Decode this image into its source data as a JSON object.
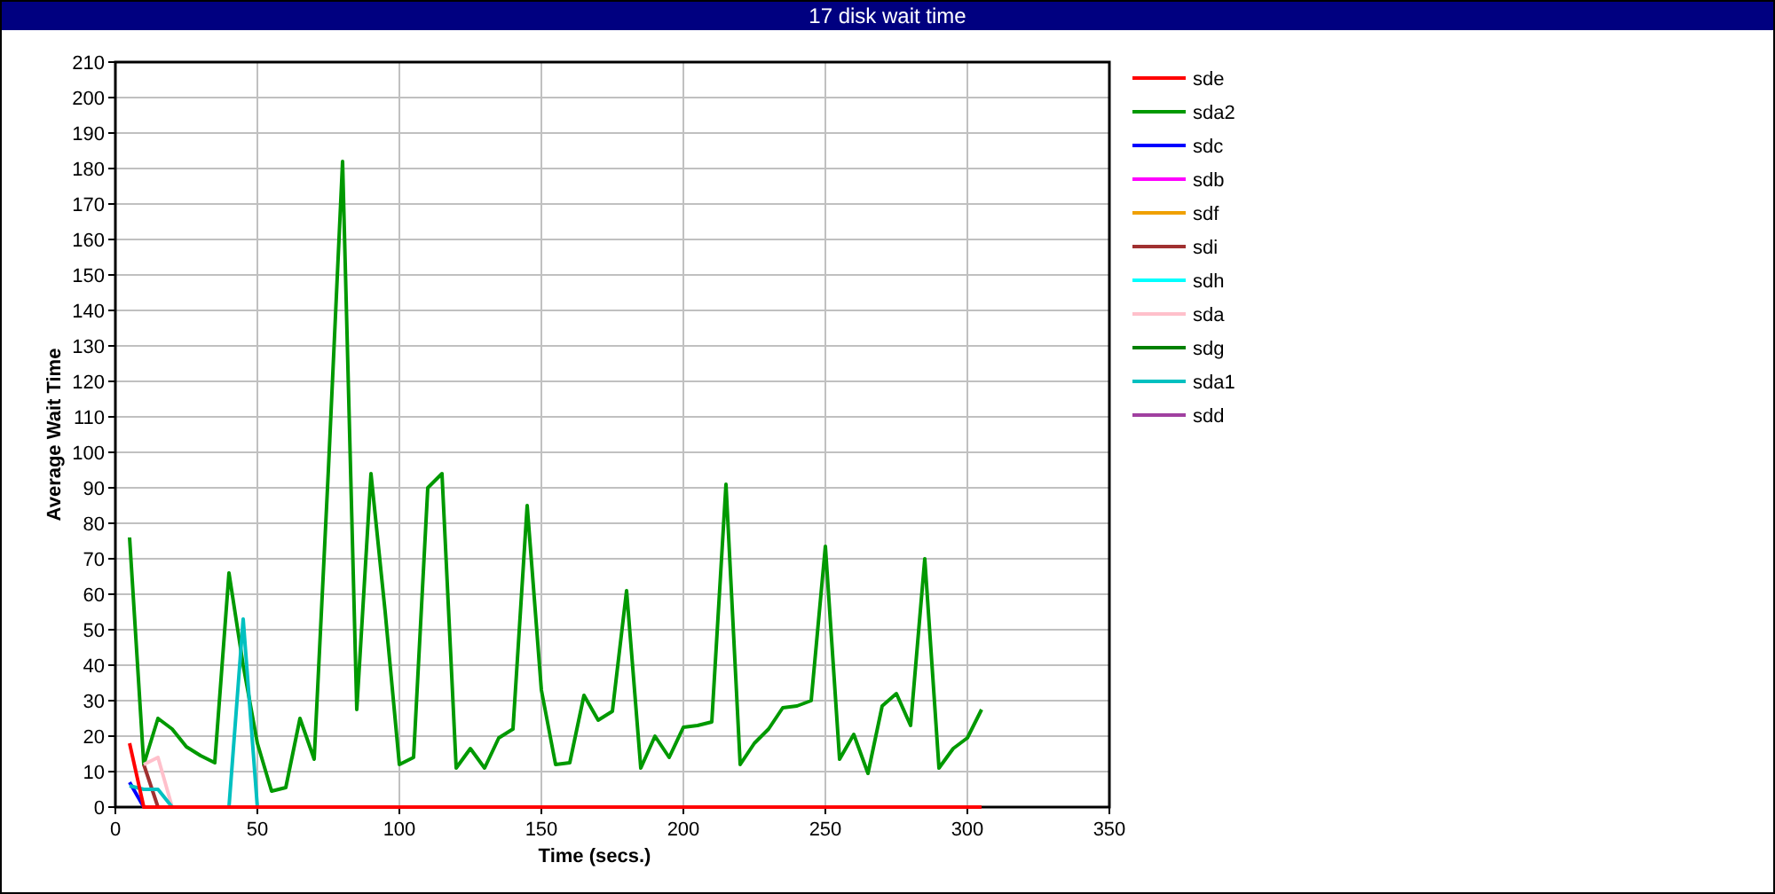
{
  "window": {
    "title": "17 disk wait time"
  },
  "chart_data": {
    "type": "line",
    "grid": true,
    "legend": true,
    "xlabel": "Time (secs.)",
    "ylabel": "Average Wait Time",
    "xlim": [
      0,
      350
    ],
    "ylim": [
      0,
      210
    ],
    "xticks": [
      0,
      50,
      100,
      150,
      200,
      250,
      300,
      350
    ],
    "yticks": [
      0,
      10,
      20,
      30,
      40,
      50,
      60,
      70,
      80,
      90,
      100,
      110,
      120,
      130,
      140,
      150,
      160,
      170,
      180,
      190,
      200,
      210
    ],
    "x": [
      5,
      10,
      15,
      20,
      25,
      30,
      35,
      40,
      45,
      50,
      55,
      60,
      65,
      70,
      75,
      80,
      85,
      90,
      95,
      100,
      105,
      110,
      115,
      120,
      125,
      130,
      135,
      140,
      145,
      150,
      155,
      160,
      165,
      170,
      175,
      180,
      185,
      190,
      195,
      200,
      205,
      210,
      215,
      220,
      225,
      230,
      235,
      240,
      245,
      250,
      255,
      260,
      265,
      270,
      275,
      280,
      285,
      290,
      295,
      300,
      305
    ],
    "series": [
      {
        "name": "sde",
        "color": "#ff0000",
        "values": [
          18,
          0,
          0,
          0,
          0,
          0,
          0,
          0,
          0,
          0,
          0,
          0,
          0,
          0,
          0,
          0,
          0,
          0,
          0,
          0,
          0,
          0,
          0,
          0,
          0,
          0,
          0,
          0,
          0,
          0,
          0,
          0,
          0,
          0,
          0,
          0,
          0,
          0,
          0,
          0,
          0,
          0,
          0,
          0,
          0,
          0,
          0,
          0,
          0,
          0,
          0,
          0,
          0,
          0,
          0,
          0,
          0,
          0,
          0,
          0,
          0
        ]
      },
      {
        "name": "sda2",
        "color": "#009900",
        "values": [
          76,
          12,
          25,
          22,
          17,
          14.5,
          12.5,
          66,
          40,
          18,
          4.5,
          5.5,
          25,
          13.5,
          95,
          182,
          27.5,
          94,
          55,
          12,
          14,
          90,
          94,
          11,
          16.5,
          11,
          19.5,
          22,
          85,
          33,
          12,
          12.5,
          31.5,
          24.5,
          27,
          61,
          11,
          20,
          14,
          22.5,
          23,
          24,
          91,
          12,
          18,
          22,
          28,
          28.5,
          30,
          73.5,
          13.5,
          20.5,
          9.5,
          28.5,
          32,
          23,
          70,
          11,
          16.5,
          19.5,
          27.5
        ]
      },
      {
        "name": "sdc",
        "color": "#0000ff",
        "values": [
          7,
          0,
          null,
          null,
          null,
          null,
          null,
          null,
          null,
          null,
          null,
          null,
          null,
          null,
          null,
          null,
          null,
          null,
          null,
          null,
          null,
          null,
          null,
          null,
          null,
          null,
          null,
          null,
          null,
          null,
          null,
          null,
          null,
          null,
          null,
          null,
          null,
          null,
          null,
          null,
          null,
          null,
          null,
          null,
          null,
          null,
          null,
          null,
          null,
          null,
          null,
          null,
          null,
          null,
          null,
          null,
          null,
          null,
          null,
          null,
          null
        ]
      },
      {
        "name": "sdb",
        "color": "#ff00ff",
        "values": [
          null,
          null,
          null,
          null,
          null,
          null,
          null,
          null,
          null,
          null,
          null,
          null,
          null,
          null,
          null,
          null,
          null,
          null,
          null,
          null,
          null,
          null,
          null,
          null,
          null,
          null,
          null,
          null,
          null,
          null,
          null,
          null,
          null,
          null,
          null,
          null,
          null,
          null,
          null,
          null,
          null,
          null,
          null,
          null,
          null,
          null,
          null,
          null,
          null,
          null,
          null,
          null,
          null,
          null,
          null,
          null,
          null,
          null,
          null,
          null,
          null
        ]
      },
      {
        "name": "sdf",
        "color": "#f0a000",
        "values": [
          null,
          null,
          null,
          null,
          null,
          null,
          null,
          null,
          null,
          null,
          null,
          null,
          null,
          null,
          null,
          null,
          null,
          null,
          null,
          null,
          null,
          null,
          null,
          null,
          null,
          null,
          null,
          null,
          null,
          null,
          null,
          null,
          null,
          null,
          null,
          null,
          null,
          null,
          null,
          null,
          null,
          null,
          null,
          null,
          null,
          null,
          null,
          null,
          null,
          null,
          null,
          null,
          null,
          null,
          null,
          null,
          null,
          null,
          null,
          null,
          null
        ]
      },
      {
        "name": "sdi",
        "color": "#a03030",
        "values": [
          null,
          12,
          0,
          null,
          null,
          null,
          null,
          null,
          null,
          null,
          null,
          null,
          null,
          null,
          null,
          null,
          null,
          null,
          null,
          null,
          null,
          null,
          null,
          null,
          null,
          null,
          null,
          null,
          null,
          null,
          null,
          null,
          null,
          null,
          null,
          null,
          null,
          null,
          null,
          null,
          null,
          null,
          null,
          null,
          null,
          null,
          null,
          null,
          null,
          null,
          null,
          null,
          null,
          null,
          null,
          null,
          null,
          null,
          null,
          null,
          null
        ]
      },
      {
        "name": "sdh",
        "color": "#00ffff",
        "values": [
          null,
          null,
          null,
          null,
          null,
          null,
          null,
          null,
          null,
          null,
          null,
          null,
          null,
          null,
          null,
          null,
          null,
          null,
          null,
          null,
          null,
          null,
          null,
          null,
          null,
          null,
          null,
          null,
          null,
          null,
          null,
          null,
          null,
          null,
          null,
          null,
          null,
          null,
          null,
          null,
          null,
          null,
          null,
          null,
          null,
          null,
          null,
          null,
          null,
          null,
          null,
          null,
          null,
          null,
          null,
          null,
          null,
          null,
          null,
          null,
          null
        ]
      },
      {
        "name": "sda",
        "color": "#ffc0cb",
        "values": [
          null,
          12,
          14,
          0,
          null,
          null,
          null,
          null,
          null,
          null,
          null,
          null,
          null,
          null,
          null,
          null,
          null,
          null,
          null,
          null,
          null,
          null,
          null,
          null,
          null,
          null,
          null,
          null,
          null,
          null,
          null,
          null,
          null,
          null,
          null,
          null,
          null,
          null,
          null,
          null,
          null,
          null,
          null,
          null,
          null,
          null,
          null,
          null,
          null,
          null,
          null,
          null,
          null,
          null,
          null,
          null,
          null,
          null,
          null,
          null,
          null
        ]
      },
      {
        "name": "sdg",
        "color": "#008000",
        "values": [
          null,
          null,
          null,
          null,
          null,
          null,
          null,
          null,
          null,
          null,
          null,
          null,
          null,
          null,
          null,
          null,
          null,
          null,
          null,
          null,
          null,
          null,
          null,
          null,
          null,
          null,
          null,
          null,
          null,
          null,
          null,
          null,
          null,
          null,
          null,
          null,
          null,
          null,
          null,
          null,
          null,
          null,
          null,
          null,
          null,
          null,
          null,
          null,
          null,
          null,
          null,
          null,
          null,
          null,
          null,
          null,
          null,
          null,
          null,
          null,
          null
        ]
      },
      {
        "name": "sda1",
        "color": "#00c0c0",
        "values": [
          6,
          5,
          5,
          0,
          0,
          0,
          0,
          0,
          53,
          0,
          null,
          null,
          null,
          null,
          null,
          null,
          null,
          null,
          null,
          null,
          null,
          null,
          null,
          null,
          null,
          null,
          null,
          null,
          null,
          null,
          null,
          null,
          null,
          null,
          null,
          null,
          null,
          null,
          null,
          null,
          null,
          null,
          null,
          null,
          null,
          null,
          null,
          null,
          null,
          null,
          null,
          null,
          null,
          null,
          null,
          null,
          null,
          null,
          null,
          null,
          null
        ]
      },
      {
        "name": "sdd",
        "color": "#a040a0",
        "values": [
          null,
          null,
          null,
          null,
          null,
          null,
          null,
          null,
          null,
          null,
          null,
          null,
          null,
          null,
          null,
          null,
          null,
          null,
          null,
          null,
          null,
          null,
          null,
          null,
          null,
          null,
          null,
          null,
          null,
          null,
          null,
          null,
          null,
          null,
          null,
          null,
          null,
          null,
          null,
          null,
          null,
          null,
          null,
          null,
          null,
          null,
          null,
          null,
          null,
          null,
          null,
          null,
          null,
          null,
          null,
          null,
          null,
          null,
          null,
          null,
          null
        ]
      }
    ]
  }
}
